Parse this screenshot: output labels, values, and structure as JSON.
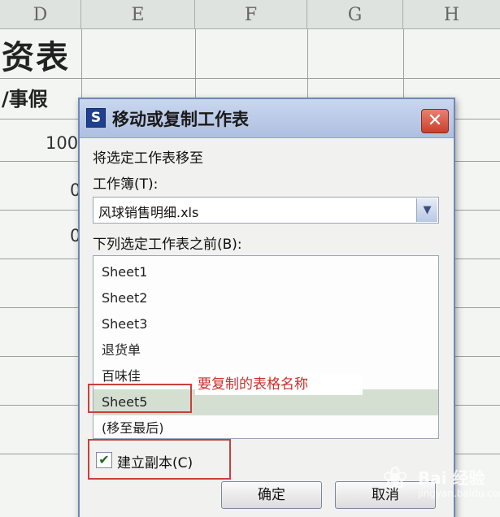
{
  "spreadsheet": {
    "columns": [
      "D",
      "E",
      "F",
      "G",
      "H"
    ],
    "title_fragment": "资表",
    "header_fragment": "/事假",
    "values": [
      "100",
      "0",
      "0"
    ]
  },
  "dialog": {
    "icon_letter": "S",
    "title": "移动或复制工作表",
    "close_symbol": "✕",
    "section_label": "将选定工作表移至",
    "workbook_label": "工作簿(T):",
    "workbook_value": "风球销售明细.xls",
    "dropdown_symbol": "▼",
    "before_label": "下列选定工作表之前(B):",
    "sheets": [
      "Sheet1",
      "Sheet2",
      "Sheet3",
      "退货单",
      "百味佳",
      "Sheet5",
      "(移至最后)"
    ],
    "selected_sheet": "Sheet5",
    "create_copy_label": "建立副本(C)",
    "create_copy_checked": true,
    "check_symbol": "✔",
    "ok_label": "确定",
    "cancel_label": "取消"
  },
  "annotation": {
    "label": "要复制的表格名称",
    "color": "#c9403a"
  },
  "watermark": {
    "text": "Bai 经验",
    "url": "jingyan.baidu.com"
  }
}
